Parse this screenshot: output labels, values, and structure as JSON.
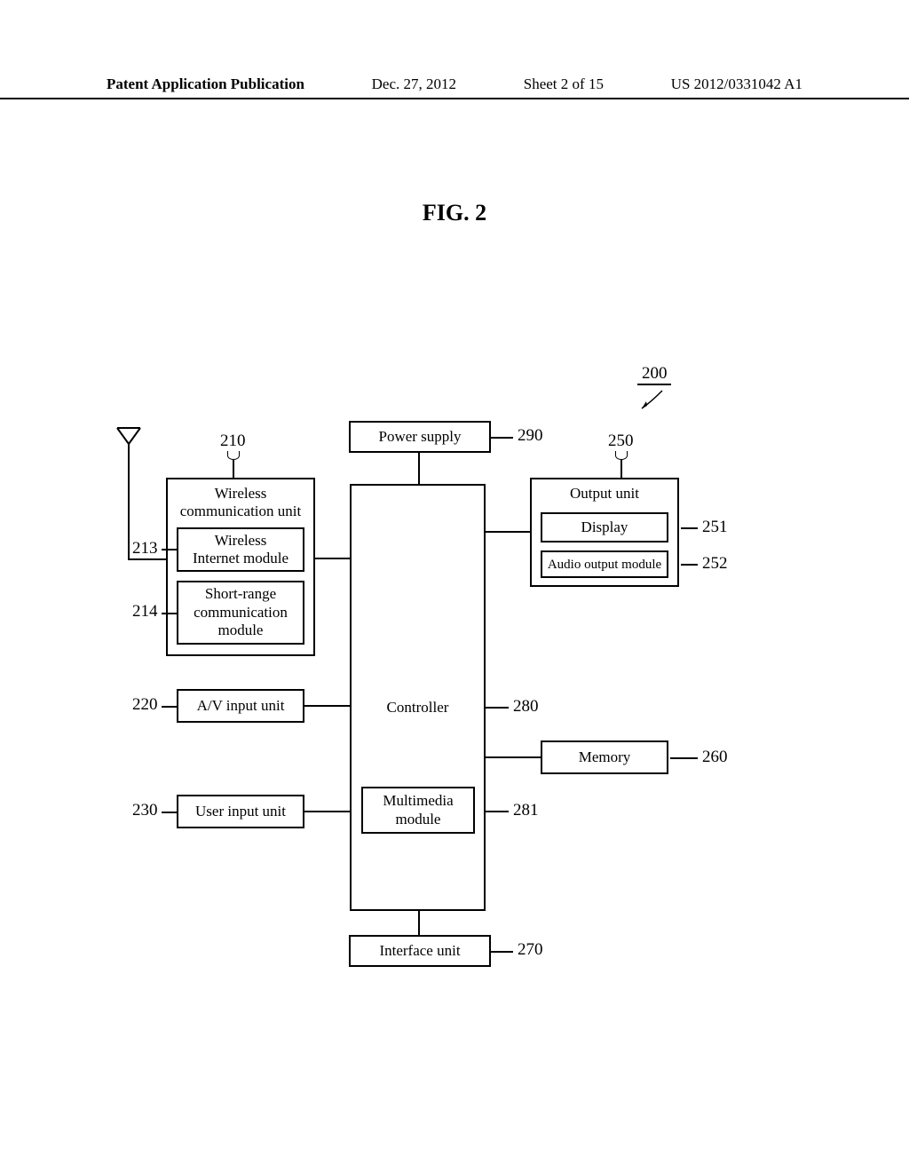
{
  "header": {
    "left": "Patent Application Publication",
    "date": "Dec. 27, 2012",
    "sheet": "Sheet 2 of 15",
    "pubno": "US 2012/0331042 A1"
  },
  "figure_title": "FIG. 2",
  "refs": {
    "r200": "200",
    "r210": "210",
    "r213": "213",
    "r214": "214",
    "r220": "220",
    "r230": "230",
    "r250": "250",
    "r251": "251",
    "r252": "252",
    "r260": "260",
    "r270": "270",
    "r280": "280",
    "r281": "281",
    "r290": "290"
  },
  "boxes": {
    "power_supply": "Power supply",
    "wireless_comm": "Wireless\ncommunication unit",
    "wireless_internet": "Wireless\nInternet module",
    "short_range": "Short-range\ncommunication\nmodule",
    "av_input": "A/V input unit",
    "user_input": "User input unit",
    "controller": "Controller",
    "multimedia": "Multimedia\nmodule",
    "output_unit": "Output unit",
    "display": "Display",
    "audio_output": "Audio output module",
    "memory": "Memory",
    "interface_unit": "Interface unit"
  }
}
